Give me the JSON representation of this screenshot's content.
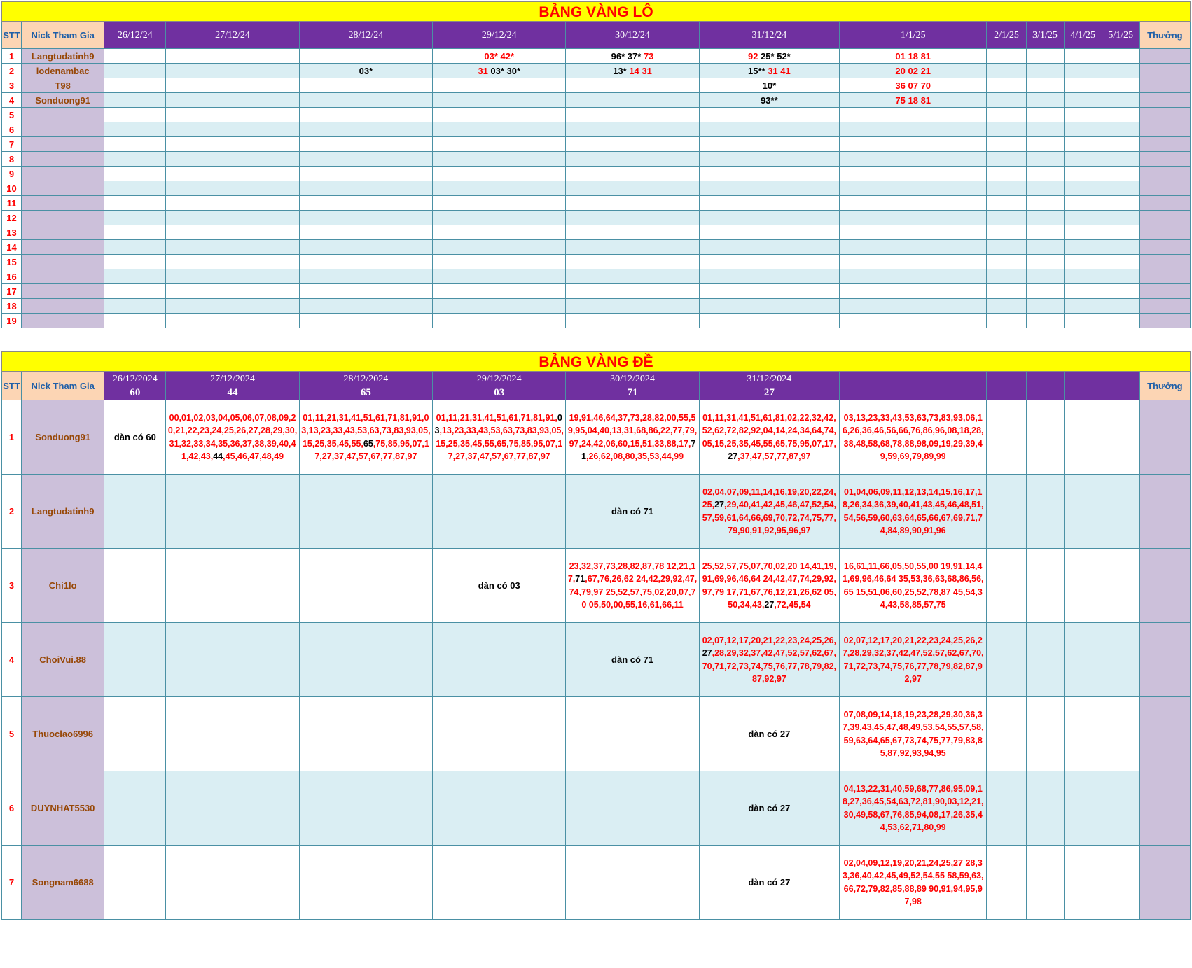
{
  "lo": {
    "title": "BẢNG VÀNG LÔ",
    "headers": {
      "stt": "STT",
      "nick": "Nick Tham Gia",
      "thuong": "Thưởng"
    },
    "dates": [
      "26/12/24",
      "27/12/24",
      "28/12/24",
      "29/12/24",
      "30/12/24",
      "31/12/24",
      "1/1/25",
      "2/1/25",
      "3/1/25",
      "4/1/25",
      "5/1/25"
    ],
    "rows": [
      {
        "stt": "1",
        "nick": "Langtudatinh9",
        "cells": [
          [],
          [],
          [],
          [
            [
              "03* 42*",
              "r"
            ]
          ],
          [
            [
              "96* 37* ",
              "k"
            ],
            [
              "73",
              "r"
            ]
          ],
          [
            [
              "92 ",
              "r"
            ],
            [
              "25* 52*",
              "k"
            ]
          ],
          [
            [
              "01 18 81",
              "r"
            ]
          ],
          [],
          [],
          [],
          []
        ]
      },
      {
        "stt": "2",
        "nick": "lodenambac",
        "cells": [
          [],
          [],
          [
            [
              "03*",
              "k"
            ]
          ],
          [
            [
              "31 ",
              "r"
            ],
            [
              "03* 30*",
              "k"
            ]
          ],
          [
            [
              "13* ",
              "k"
            ],
            [
              "14 31",
              "r"
            ]
          ],
          [
            [
              "15** ",
              "k"
            ],
            [
              "31 41",
              "r"
            ]
          ],
          [
            [
              "20 02 21",
              "r"
            ]
          ],
          [],
          [],
          [],
          []
        ]
      },
      {
        "stt": "3",
        "nick": "T98",
        "cells": [
          [],
          [],
          [],
          [],
          [],
          [
            [
              "10*",
              "k"
            ]
          ],
          [
            [
              "36 07 70",
              "r"
            ]
          ],
          [],
          [],
          [],
          []
        ]
      },
      {
        "stt": "4",
        "nick": "Sonduong91",
        "cells": [
          [],
          [],
          [],
          [],
          [],
          [
            [
              "93**",
              "k"
            ]
          ],
          [
            [
              "75 18 81",
              "r"
            ]
          ],
          [],
          [],
          [],
          []
        ]
      },
      {
        "stt": "5",
        "nick": "",
        "cells": []
      },
      {
        "stt": "6",
        "nick": "",
        "cells": []
      },
      {
        "stt": "7",
        "nick": "",
        "cells": []
      },
      {
        "stt": "8",
        "nick": "",
        "cells": []
      },
      {
        "stt": "9",
        "nick": "",
        "cells": []
      },
      {
        "stt": "10",
        "nick": "",
        "cells": []
      },
      {
        "stt": "11",
        "nick": "",
        "cells": []
      },
      {
        "stt": "12",
        "nick": "",
        "cells": []
      },
      {
        "stt": "13",
        "nick": "",
        "cells": []
      },
      {
        "stt": "14",
        "nick": "",
        "cells": []
      },
      {
        "stt": "15",
        "nick": "",
        "cells": []
      },
      {
        "stt": "16",
        "nick": "",
        "cells": []
      },
      {
        "stt": "17",
        "nick": "",
        "cells": []
      },
      {
        "stt": "18",
        "nick": "",
        "cells": []
      },
      {
        "stt": "19",
        "nick": "",
        "cells": []
      }
    ]
  },
  "de": {
    "title": "BẢNG VÀNG ĐỀ",
    "headers": {
      "stt": "STT",
      "nick": "Nick Tham Gia",
      "thuong": "Thưởng"
    },
    "dates": [
      "26/12/2024",
      "27/12/2024",
      "28/12/2024",
      "29/12/2024",
      "30/12/2024",
      "31/12/2024",
      "",
      "",
      "",
      "",
      ""
    ],
    "results": [
      "60",
      "44",
      "65",
      "03",
      "71",
      "27",
      "",
      "",
      "",
      "",
      ""
    ],
    "rows": [
      {
        "stt": "1",
        "nick": "Sonduong91",
        "cells": [
          {
            "note": "dàn có 60"
          },
          {
            "text": "00,01,02,03,04,05,06,07,08,09,20,21,22,23,24,25,26,27,28,29,30,31,32,33,34,35,36,37,38,39,40,41,42,43,44,45,46,47,48,49",
            "hit": "44"
          },
          {
            "text": "01,11,21,31,41,51,61,71,81,91,03,13,23,33,43,53,63,73,83,93,05,15,25,35,45,55,65,75,85,95,07,17,27,37,47,57,67,77,87,97",
            "hit": "65"
          },
          {
            "text": "01,11,21,31,41,51,61,71,81,91,03,13,23,33,43,53,63,73,83,93,05,15,25,35,45,55,65,75,85,95,07,17,27,37,47,57,67,77,87,97",
            "hit": "03"
          },
          {
            "text": "19,91,46,64,37,73,28,82,00,55,59,95,04,40,13,31,68,86,22,77,79,97,24,42,06,60,15,51,33,88,17,71,26,62,08,80,35,53,44,99",
            "hit": "71"
          },
          {
            "text": "01,11,31,41,51,61,81,02,22,32,42,52,62,72,82,92,04,14,24,34,64,74,05,15,25,35,45,55,65,75,95,07,17,27,37,47,57,77,87,97",
            "hit": "27"
          },
          {
            "text": "03,13,23,33,43,53,63,73,83,93,06,16,26,36,46,56,66,76,86,96,08,18,28,38,48,58,68,78,88,98,09,19,29,39,49,59,69,79,89,99",
            "hit": ""
          },
          {},
          {},
          {},
          {}
        ]
      },
      {
        "stt": "2",
        "nick": "Langtudatinh9",
        "cells": [
          {},
          {},
          {},
          {},
          {
            "note": "dàn có 71"
          },
          {
            "text": "02,04,07,09,11,14,16,19,20,22,24,25,27,29,40,41,42,45,46,47,52,54,57,59,61,64,66,69,70,72,74,75,77,79,90,91,92,95,96,97",
            "hit": "27"
          },
          {
            "text": "01,04,06,09,11,12,13,14,15,16,17,18,26,34,36,39,40,41,43,45,46,48,51,54,56,59,60,63,64,65,66,67,69,71,74,84,89,90,91,96",
            "hit": ""
          },
          {},
          {},
          {},
          {}
        ]
      },
      {
        "stt": "3",
        "nick": "Chi1lo",
        "cells": [
          {},
          {},
          {},
          {
            "note": "dàn có 03"
          },
          {
            "text": "23,32,37,73,28,82,87,78 12,21,17,71,67,76,26,62 24,42,29,92,47,74,79,97 25,52,57,75,02,20,07,70 05,50,00,55,16,61,66,11",
            "hit": "71"
          },
          {
            "text": "25,52,57,75,07,70,02,20 14,41,19,91,69,96,46,64 24,42,47,74,29,92,97,79 17,71,67,76,12,21,26,62 05,50,34,43,27,72,45,54",
            "hit": "27"
          },
          {
            "text": "16,61,11,66,05,50,55,00 19,91,14,41,69,96,46,64 35,53,36,63,68,86,56,65 15,51,06,60,25,52,78,87 45,54,34,43,58,85,57,75",
            "hit": ""
          },
          {},
          {},
          {},
          {}
        ]
      },
      {
        "stt": "4",
        "nick": "ChoiVui.88",
        "cells": [
          {},
          {},
          {},
          {},
          {
            "note": "dàn có 71"
          },
          {
            "text": "02,07,12,17,20,21,22,23,24,25,26,27,28,29,32,37,42,47,52,57,62,67,70,71,72,73,74,75,76,77,78,79,82,87,92,97",
            "hit": "27"
          },
          {
            "text": "02,07,12,17,20,21,22,23,24,25,26,27,28,29,32,37,42,47,52,57,62,67,70,71,72,73,74,75,76,77,78,79,82,87,92,97",
            "hit": ""
          },
          {},
          {},
          {},
          {}
        ]
      },
      {
        "stt": "5",
        "nick": "Thuoclao6996",
        "cells": [
          {},
          {},
          {},
          {},
          {},
          {
            "note": "dàn có 27"
          },
          {
            "text": "07,08,09,14,18,19,23,28,29,30,36,37,39,43,45,47,48,49,53,54,55,57,58,59,63,64,65,67,73,74,75,77,79,83,85,87,92,93,94,95",
            "hit": ""
          },
          {},
          {},
          {},
          {}
        ]
      },
      {
        "stt": "6",
        "nick": "DUYNHAT5530",
        "cells": [
          {},
          {},
          {},
          {},
          {},
          {
            "note": "dàn có 27"
          },
          {
            "text": "04,13,22,31,40,59,68,77,86,95,09,18,27,36,45,54,63,72,81,90,03,12,21,30,49,58,67,76,85,94,08,17,26,35,44,53,62,71,80,99",
            "hit": ""
          },
          {},
          {},
          {},
          {}
        ]
      },
      {
        "stt": "7",
        "nick": "Songnam6688",
        "cells": [
          {},
          {},
          {},
          {},
          {},
          {
            "note": "dàn có 27"
          },
          {
            "text": "02,04,09,12,19,20,21,24,25,27 28,33,36,40,42,45,49,52,54,55 58,59,63,66,72,79,82,85,88,89 90,91,94,95,97,98",
            "hit": ""
          },
          {},
          {},
          {},
          {}
        ]
      }
    ]
  }
}
